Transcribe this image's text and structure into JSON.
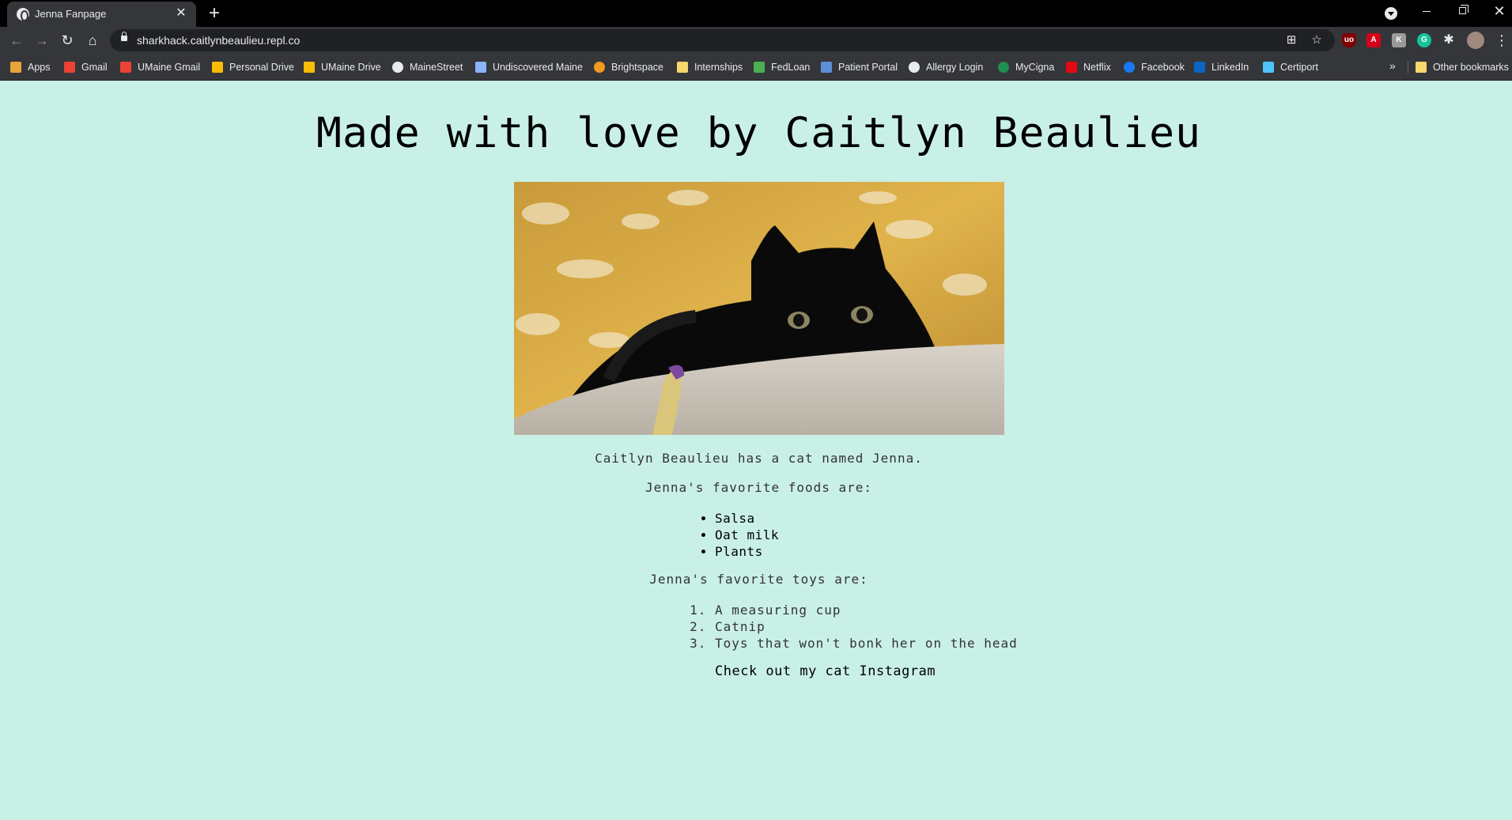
{
  "browser": {
    "tab_title": "Jenna Fanpage",
    "url": "sharkhack.caitlynbeaulieu.repl.co"
  },
  "bookmarks": {
    "items": [
      {
        "label": "Apps",
        "icon": "apps-grid-icon",
        "color": "#e8a33a"
      },
      {
        "label": "Gmail",
        "icon": "gmail-icon",
        "color": "#ea4335"
      },
      {
        "label": "UMaine Gmail",
        "icon": "gmail-icon",
        "color": "#ea4335"
      },
      {
        "label": "Personal Drive",
        "icon": "drive-icon",
        "color": "#fbbc04"
      },
      {
        "label": "UMaine Drive",
        "icon": "drive-icon",
        "color": "#fbbc04"
      },
      {
        "label": "MaineStreet",
        "icon": "globe-icon",
        "color": "#e8eaed"
      },
      {
        "label": "Undiscovered Maine",
        "icon": "book-icon",
        "color": "#8ab4f8"
      },
      {
        "label": "Brightspace",
        "icon": "brightspace-icon",
        "color": "#f29a1e"
      },
      {
        "label": "Internships",
        "icon": "folder-icon",
        "color": "#f5d76e"
      },
      {
        "label": "FedLoan",
        "icon": "fedloan-icon",
        "color": "#4caf50"
      },
      {
        "label": "Patient Portal",
        "icon": "heart-icon",
        "color": "#5c8fd6"
      },
      {
        "label": "Allergy Login",
        "icon": "allergy-icon",
        "color": "#e8eaed"
      },
      {
        "label": "MyCigna",
        "icon": "cigna-icon",
        "color": "#1e8f4e"
      },
      {
        "label": "Netflix",
        "icon": "netflix-icon",
        "color": "#e50914"
      },
      {
        "label": "Facebook",
        "icon": "facebook-icon",
        "color": "#1877f2"
      },
      {
        "label": "LinkedIn",
        "icon": "linkedin-icon",
        "color": "#0a66c2"
      },
      {
        "label": "Certiport",
        "icon": "certiport-icon",
        "color": "#4fc3f7"
      }
    ],
    "overflow": "»",
    "other": "Other bookmarks"
  },
  "page": {
    "title": "Made with love by Caitlyn Beaulieu",
    "intro": "Caitlyn Beaulieu has a cat named Jenna.",
    "foods_heading": "Jenna's favorite foods are:",
    "foods": [
      "Salsa",
      "Oat milk",
      "Plants"
    ],
    "toys_heading": "Jenna's favorite toys are:",
    "toys": [
      "A measuring cup",
      "Catnip",
      "Toys that won't bonk her on the head"
    ],
    "link_text": "Check out my cat Instagram"
  }
}
